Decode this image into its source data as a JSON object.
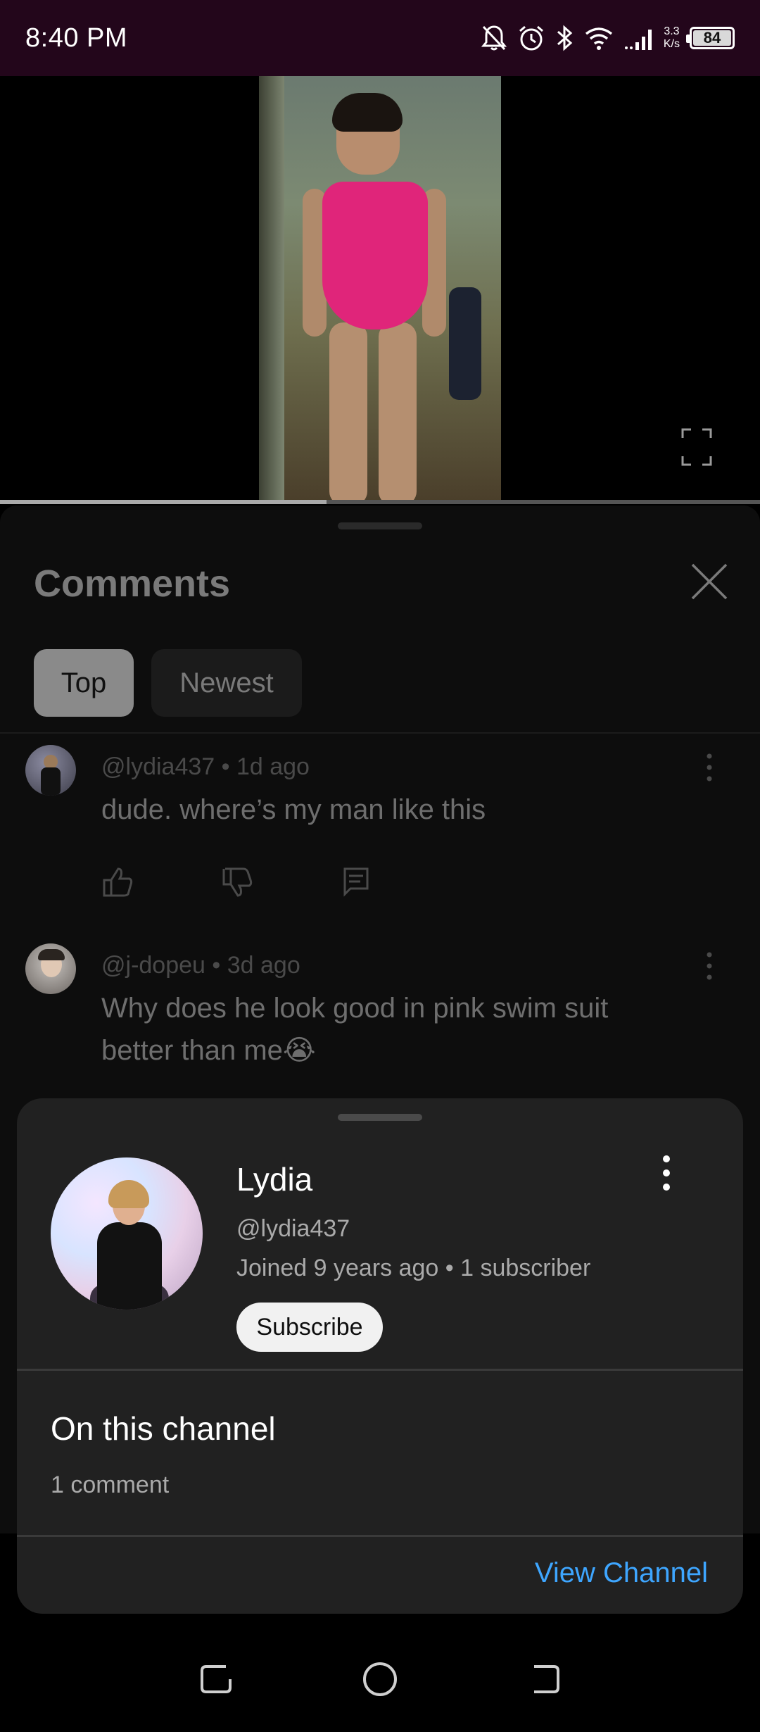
{
  "status_bar": {
    "time": "8:40 PM",
    "speed_top": "3.3",
    "speed_bottom": "K/s",
    "battery": "84"
  },
  "comments_panel": {
    "title": "Comments",
    "filters": [
      "Top",
      "Newest"
    ],
    "items": [
      {
        "meta": "@lydia437 • 1d ago",
        "text": "dude. where’s my man like this"
      },
      {
        "meta": "@j-dopeu • 3d ago",
        "text": "Why does he look good in pink swim suit better than me😭"
      }
    ]
  },
  "channel_sheet": {
    "name": "Lydia",
    "handle": "@lydia437",
    "joined": "Joined 9 years ago • 1 subscriber",
    "subscribe_label": "Subscribe",
    "section_title": "On this channel",
    "comment_count": "1 comment",
    "view_channel_label": "View Channel"
  },
  "video": {
    "progress": 0.43
  }
}
